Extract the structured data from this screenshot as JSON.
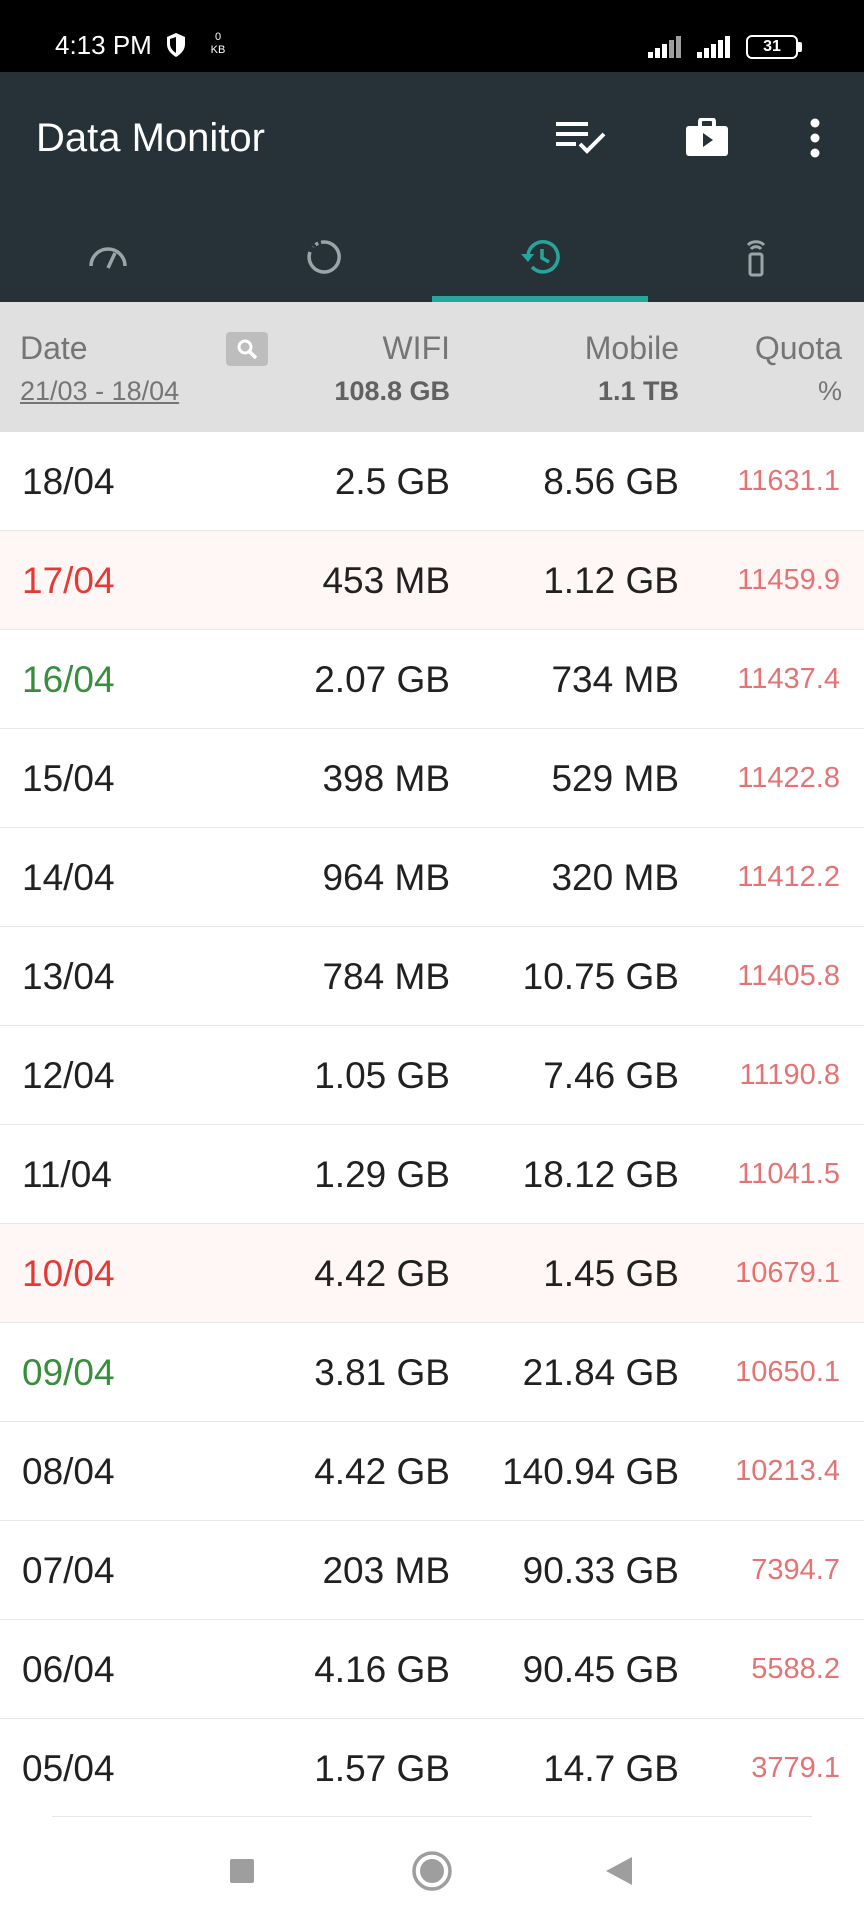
{
  "status_bar": {
    "time": "4:13 PM",
    "speed_value": "0",
    "speed_unit": "KB",
    "battery": "31",
    "icons": [
      "shield-icon",
      "signal-icon",
      "signal-icon",
      "battery-icon"
    ]
  },
  "app_bar": {
    "title": "Data Monitor",
    "actions": [
      "checklist-icon",
      "briefcase-icon",
      "more-vert-icon"
    ]
  },
  "tabs": [
    {
      "icon": "speedometer-icon",
      "selected": false
    },
    {
      "icon": "refresh-circle-icon",
      "selected": false
    },
    {
      "icon": "history-icon",
      "selected": true
    },
    {
      "icon": "sim-card-icon",
      "selected": false
    }
  ],
  "colors": {
    "app_bar": "#263238",
    "accent": "#26a69a",
    "date_red": "#e53935",
    "date_green": "#388e3c",
    "quota": "#e57373"
  },
  "table": {
    "columns": {
      "date": "Date",
      "wifi": "WIFI",
      "mobile": "Mobile",
      "quota": "Quota"
    },
    "range": "21/03 - 18/04",
    "wifi_total": "108.8 GB",
    "mobile_total": "1.1 TB",
    "quota_unit": "%",
    "rows": [
      {
        "date": "18/04",
        "wifi": "2.5 GB",
        "mobile": "8.56 GB",
        "quota": "11631.1"
      },
      {
        "date": "17/04",
        "wifi": "453 MB",
        "mobile": "1.12 GB",
        "quota": "11459.9"
      },
      {
        "date": "16/04",
        "wifi": "2.07 GB",
        "mobile": "734 MB",
        "quota": "11437.4"
      },
      {
        "date": "15/04",
        "wifi": "398 MB",
        "mobile": "529 MB",
        "quota": "11422.8"
      },
      {
        "date": "14/04",
        "wifi": "964 MB",
        "mobile": "320 MB",
        "quota": "11412.2"
      },
      {
        "date": "13/04",
        "wifi": "784 MB",
        "mobile": "10.75 GB",
        "quota": "11405.8"
      },
      {
        "date": "12/04",
        "wifi": "1.05 GB",
        "mobile": "7.46 GB",
        "quota": "11190.8"
      },
      {
        "date": "11/04",
        "wifi": "1.29 GB",
        "mobile": "18.12 GB",
        "quota": "11041.5"
      },
      {
        "date": "10/04",
        "wifi": "4.42 GB",
        "mobile": "1.45 GB",
        "quota": "10679.1"
      },
      {
        "date": "09/04",
        "wifi": "3.81 GB",
        "mobile": "21.84 GB",
        "quota": "10650.1"
      },
      {
        "date": "08/04",
        "wifi": "4.42 GB",
        "mobile": "140.94 GB",
        "quota": "10213.4"
      },
      {
        "date": "07/04",
        "wifi": "203 MB",
        "mobile": "90.33 GB",
        "quota": "7394.7"
      },
      {
        "date": "06/04",
        "wifi": "4.16 GB",
        "mobile": "90.45 GB",
        "quota": "5588.2"
      },
      {
        "date": "05/04",
        "wifi": "1.57 GB",
        "mobile": "14.7 GB",
        "quota": "3779.1"
      }
    ]
  },
  "nav_bar": [
    "recents-square-icon",
    "home-circle-icon",
    "back-triangle-icon"
  ]
}
